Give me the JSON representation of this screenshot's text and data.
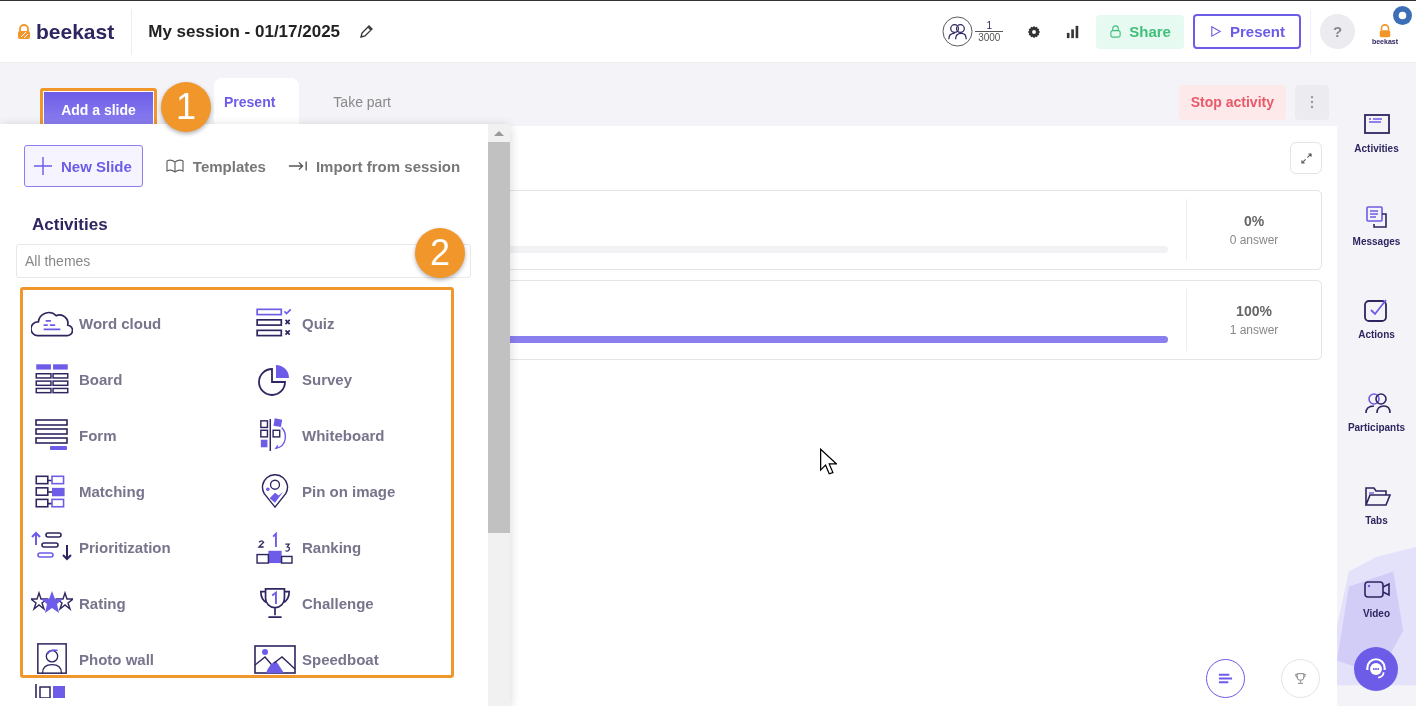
{
  "header": {
    "logo": "beekast",
    "title": "My session - 01/17/2025",
    "participants": {
      "count": "1",
      "max": "3000"
    },
    "share": "Share",
    "present": "Present",
    "help": "?",
    "account_label": "beekast"
  },
  "add_slide": {
    "label": "Add a slide",
    "callout": "1"
  },
  "tabs": [
    {
      "label": "Present",
      "selected": true
    },
    {
      "label": "Take part",
      "selected": false
    }
  ],
  "stop_activity": "Stop activity",
  "results": [
    {
      "percent": "0%",
      "answers": "0 answer",
      "level": 0
    },
    {
      "percent": "100%",
      "answers": "1 answer",
      "level": 1
    }
  ],
  "add_panel": {
    "actions": [
      {
        "kind": "new",
        "label": "New Slide"
      },
      {
        "kind": "templates",
        "label": "Templates"
      },
      {
        "kind": "import",
        "label": "Import from session"
      }
    ],
    "section": "Activities",
    "theme_filter": {
      "placeholder": "All themes"
    },
    "callout": "2",
    "activities": [
      {
        "kind": "word-cloud",
        "label": "Word cloud"
      },
      {
        "kind": "quiz",
        "label": "Quiz"
      },
      {
        "kind": "board",
        "label": "Board"
      },
      {
        "kind": "survey",
        "label": "Survey"
      },
      {
        "kind": "form",
        "label": "Form"
      },
      {
        "kind": "whiteboard",
        "label": "Whiteboard"
      },
      {
        "kind": "matching",
        "label": "Matching"
      },
      {
        "kind": "pin",
        "label": "Pin on image"
      },
      {
        "kind": "prioritization",
        "label": "Prioritization"
      },
      {
        "kind": "ranking",
        "label": "Ranking"
      },
      {
        "kind": "rating",
        "label": "Rating"
      },
      {
        "kind": "challenge",
        "label": "Challenge"
      },
      {
        "kind": "photo-wall",
        "label": "Photo wall"
      },
      {
        "kind": "speedboat",
        "label": "Speedboat"
      }
    ],
    "partial_activity": {
      "kind": "split"
    }
  },
  "sidebar": [
    {
      "kind": "activities",
      "label": "Activities"
    },
    {
      "kind": "messages",
      "label": "Messages"
    },
    {
      "kind": "actions",
      "label": "Actions"
    },
    {
      "kind": "participants",
      "label": "Participants"
    },
    {
      "kind": "tabs",
      "label": "Tabs"
    },
    {
      "kind": "video",
      "label": "Video"
    }
  ]
}
